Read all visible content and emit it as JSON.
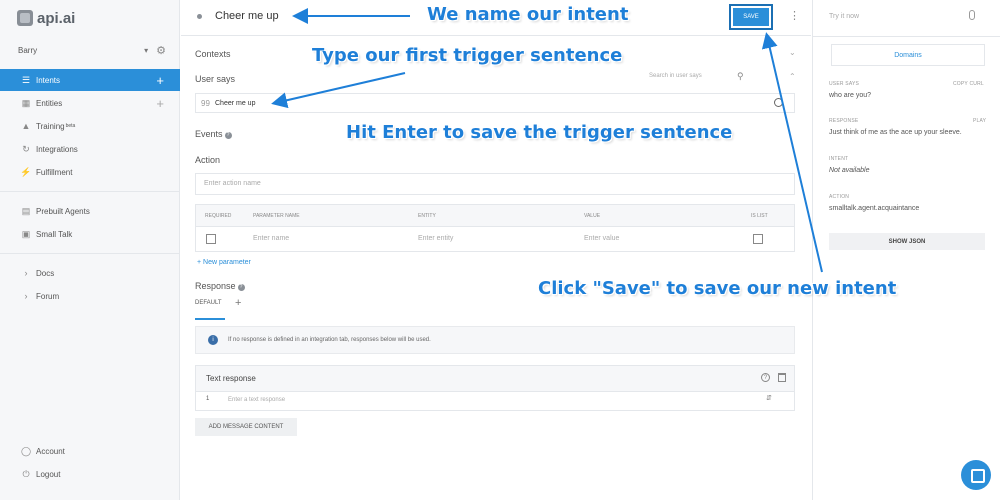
{
  "brand": {
    "logo_text": "api.ai"
  },
  "agent": {
    "name": "Barry"
  },
  "sidebar": {
    "items": [
      {
        "label": "Intents",
        "icon": "chat-icon",
        "active": true
      },
      {
        "label": "Entities",
        "icon": "entities-icon"
      },
      {
        "label": "Training",
        "badge": "beta",
        "icon": "graduation-cap-icon"
      },
      {
        "label": "Integrations",
        "icon": "integrations-icon"
      },
      {
        "label": "Fulfillment",
        "icon": "lightning-icon"
      },
      {
        "label": "Prebuilt Agents",
        "icon": "prebuilt-icon"
      },
      {
        "label": "Small Talk",
        "icon": "smalltalk-icon"
      },
      {
        "label": "Docs",
        "icon": "chevron-right-icon"
      },
      {
        "label": "Forum",
        "icon": "chevron-right-icon"
      }
    ],
    "bottom": [
      {
        "label": "Account",
        "icon": "account-icon"
      },
      {
        "label": "Logout",
        "icon": "power-icon"
      }
    ]
  },
  "intent": {
    "name": "Cheer me up",
    "save_label": "SAVE",
    "contexts_label": "Contexts",
    "user_says_label": "User says",
    "search_placeholder": "Search in user says",
    "phrase_quote": "99",
    "phrases": [
      "Cheer me up"
    ],
    "events_label": "Events",
    "action_label": "Action",
    "action_placeholder": "Enter action name",
    "param_headers": {
      "required": "REQUIRED",
      "name": "PARAMETER NAME",
      "entity": "ENTITY",
      "value": "VALUE",
      "islist": "IS LIST"
    },
    "param_row": {
      "name": "Enter name",
      "entity": "Enter entity",
      "value": "Enter value"
    },
    "new_parameter": "+ New parameter",
    "response_label": "Response",
    "default_tab": "DEFAULT",
    "info_note": "If no response is defined in an integration tab, responses below will be used.",
    "text_response_label": "Text response",
    "text_response_index": "1",
    "text_response_placeholder": "Enter a text response",
    "add_message_content": "ADD MESSAGE CONTENT"
  },
  "try_panel": {
    "try_label": "Try it now",
    "domains_tab": "Domains",
    "user_says_label": "USER SAYS",
    "copy_curl": "COPY CURL",
    "user_says_value": "who are you?",
    "response_label": "RESPONSE",
    "play_label": "PLAY",
    "response_value": "Just think of me as the ace up your sleeve.",
    "intent_label": "INTENT",
    "intent_value": "Not available",
    "action_label": "ACTION",
    "action_value": "smalltalk.agent.acquaintance",
    "show_json": "SHOW JSON"
  },
  "annotations": {
    "name_intent": "We name our intent",
    "trigger": "Type our first trigger sentence",
    "enter": "Hit Enter to save the trigger sentence",
    "save": "Click \"Save\" to save our new intent"
  },
  "colors": {
    "accent": "#2b8fd9",
    "annotation": "#1e7fd8",
    "sidebar_bg": "#f6f7f9"
  }
}
